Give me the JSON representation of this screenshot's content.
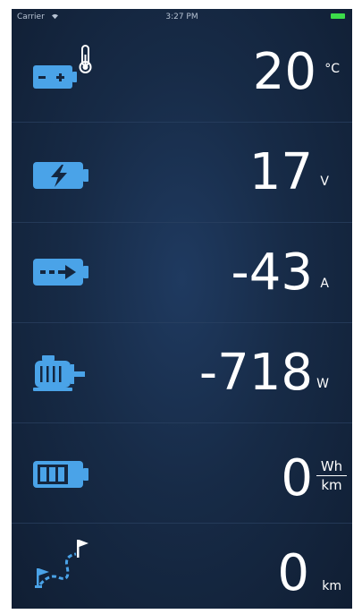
{
  "status_bar": {
    "carrier": "Carrier",
    "time": "3:27 PM"
  },
  "accent_color": "#4aa3e8",
  "rows": [
    {
      "icon": "battery-temperature-icon",
      "value": "20",
      "unit": "°C"
    },
    {
      "icon": "battery-voltage-icon",
      "value": "17",
      "unit": "V"
    },
    {
      "icon": "battery-current-icon",
      "value": "-43",
      "unit": "A"
    },
    {
      "icon": "motor-power-icon",
      "value": "-718",
      "unit": "W"
    },
    {
      "icon": "battery-consumption-icon",
      "value": "0",
      "unit_numerator": "Wh",
      "unit_denominator": "km"
    },
    {
      "icon": "route-distance-icon",
      "value": "0",
      "unit": "km"
    }
  ]
}
